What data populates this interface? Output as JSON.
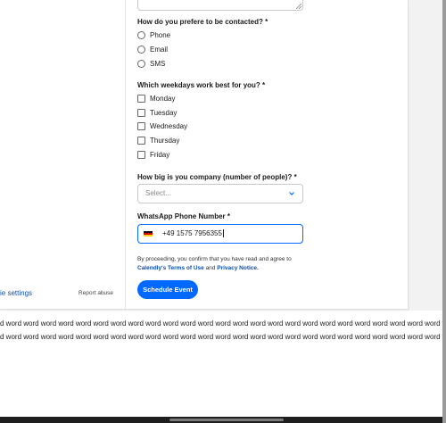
{
  "form": {
    "contact_question": "How do you prefere to be contacted? *",
    "contact_options": [
      "Phone",
      "Email",
      "SMS"
    ],
    "weekday_question": "Which weekdays work best for you? *",
    "weekday_options": [
      "Monday",
      "Tuesday",
      "Wednesday",
      "Thursday",
      "Friday"
    ],
    "company_size_question": "How big is you company (number of people)? *",
    "company_size_placeholder": "Select...",
    "whatsapp_label": "WhatsApp Phone Number *",
    "whatsapp_value": "+49 1575 7956355",
    "consent_prefix": "By proceeding, you confirm that you have read and agree to",
    "terms_link": "Calendly's Terms of Use",
    "consent_and": " and ",
    "privacy_link": "Privacy Notice.",
    "submit_label": "Schedule Event"
  },
  "footer": {
    "cookie_settings": "ie settings",
    "report_abuse": "Report abuse"
  },
  "filler_text": {
    "line1": "d word word word word word word word word word word word word word word word word word word word word word word word word word word word word word word word word wo",
    "line2": "d word word word word word word word word word word word word word word word word word word word word word word word word word word word word word word word word wo"
  },
  "colors": {
    "accent": "#0069ff",
    "link": "#0a4ea8"
  },
  "icons": {
    "flag": "germany-flag-icon",
    "select_arrow": "chevron-down-icon"
  }
}
